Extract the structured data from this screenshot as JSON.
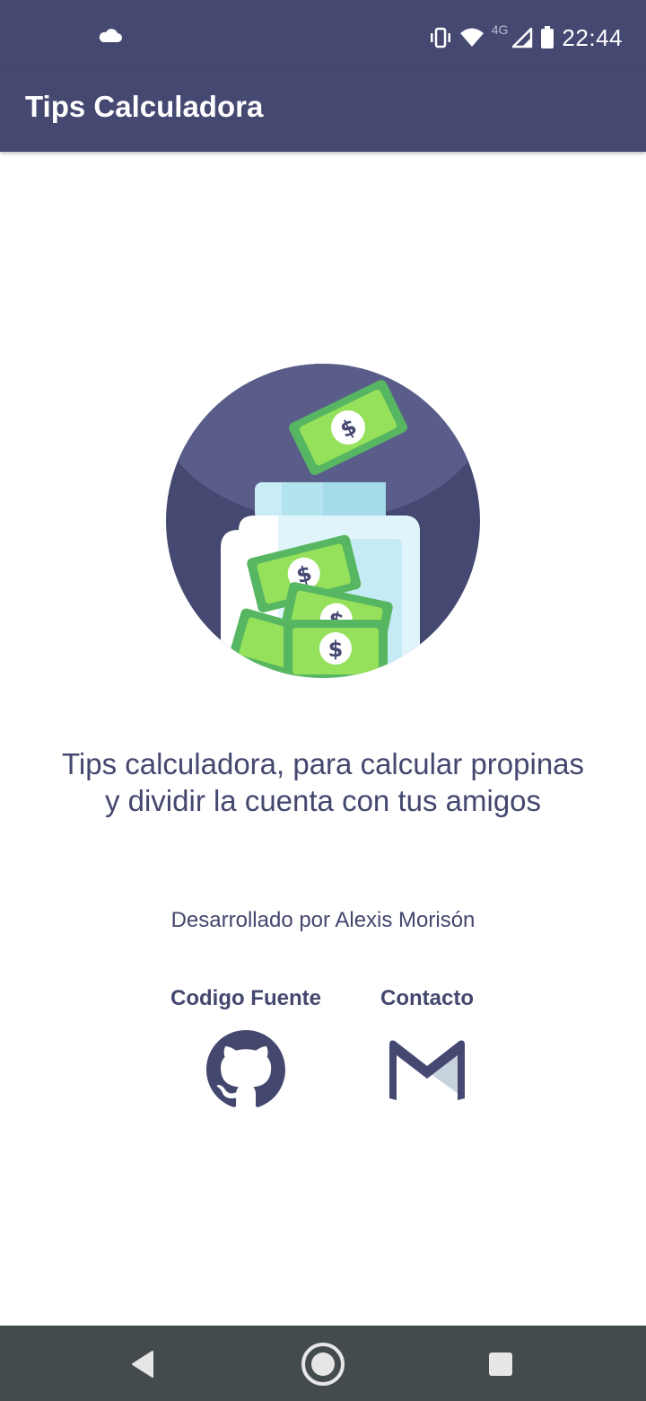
{
  "status_bar": {
    "time": "22:44",
    "network_label": "4G",
    "icons": [
      "cloud-icon",
      "vibrate-icon",
      "wifi-icon",
      "signal-icon",
      "battery-icon"
    ]
  },
  "app_bar": {
    "title": "Tips Calculadora"
  },
  "main": {
    "description": "Tips calculadora, para calcular propinas y dividir la cuenta con tus amigos",
    "developer": "Desarrollado por Alexis Morisón",
    "links": {
      "source_label": "Codigo Fuente",
      "source_icon": "github-icon",
      "contact_label": "Contacto",
      "contact_icon": "mail-icon"
    }
  },
  "nav_bar": {
    "icons": [
      "back-icon",
      "home-icon",
      "recents-icon"
    ]
  },
  "colors": {
    "primary": "#454870",
    "text": "#44476e",
    "money_green": "#57b661",
    "money_light": "#96e15c",
    "jar": "#c8edf6",
    "navbar": "#444b4e"
  }
}
